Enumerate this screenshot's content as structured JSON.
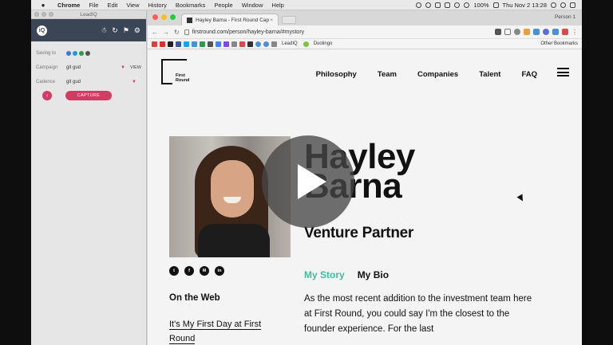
{
  "menubar": {
    "app": "Chrome",
    "items": [
      "File",
      "Edit",
      "View",
      "History",
      "Bookmarks",
      "People",
      "Window",
      "Help"
    ],
    "battery": "100%",
    "datetime": "Thu Nov 2  13:28"
  },
  "leadiq": {
    "window_title": "LeadIQ",
    "logo": "iQ",
    "saving_to_label": "Saving to",
    "campaign_label": "Campaign",
    "campaign_value": "git gud",
    "view_label": "VIEW",
    "cadence_label": "Cadence",
    "cadence_value": "git gud",
    "capture_label": "CAPTURE"
  },
  "browser": {
    "tab_title": "Hayley Barna - First Round Cap",
    "person": "Person 1",
    "url": "firstround.com/person/hayley-barna/#mystory",
    "bookmarks": [
      "LeadIQ",
      "Duolingo"
    ],
    "other_bookmarks": "Other Bookmarks"
  },
  "page": {
    "logo_text_1": "First",
    "logo_text_2": "Round",
    "nav": [
      "Philosophy",
      "Team",
      "Companies",
      "Talent",
      "FAQ"
    ],
    "name_first": "Hayley",
    "name_last": "Barna",
    "role": "Venture Partner",
    "tab_story": "My Story",
    "tab_bio": "My Bio",
    "on_the_web": "On the Web",
    "web_link": "It's My First Day at First Round",
    "story_text": "As the most recent addition to the investment team here at First Round, you could say I'm the closest to the founder experience. For the last",
    "social": [
      "t",
      "f",
      "M",
      "in"
    ]
  },
  "colors": {
    "accent_teal": "#3bbfa0",
    "leadiq_pink": "#d63a62",
    "leadiq_header": "#3a4555"
  }
}
